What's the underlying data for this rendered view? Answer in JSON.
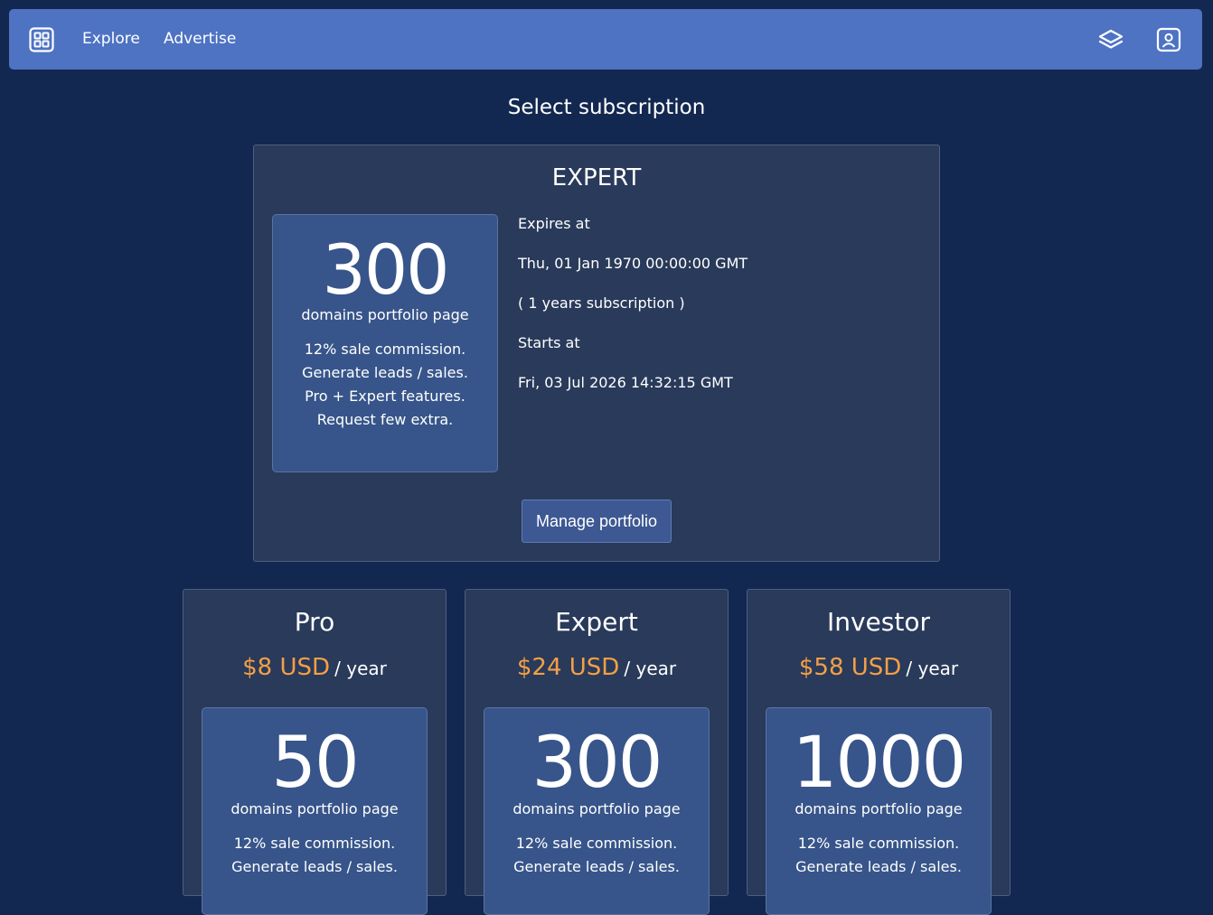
{
  "nav": {
    "logo_icon": "grid-icon",
    "links": [
      "Explore",
      "Advertise"
    ],
    "right_icons": [
      "layers-icon",
      "profile-icon"
    ]
  },
  "page_title": "Select subscription",
  "current": {
    "tier": "EXPERT",
    "count": "300",
    "count_label": "domains portfolio page",
    "features": [
      "12% sale commission.",
      "Generate leads / sales.",
      "Pro + Expert features.",
      "Request few extra."
    ],
    "expires_label": "Expires at",
    "expires_value": "Thu, 01 Jan 1970 00:00:00 GMT",
    "duration": "( 1 years subscription )",
    "starts_label": "Starts at",
    "starts_value": "Fri, 03 Jul 2026 14:32:15 GMT",
    "manage_button": "Manage portfolio"
  },
  "plans": [
    {
      "name": "Pro",
      "price": "$8 USD",
      "period": "/ year",
      "count": "50",
      "count_label": "domains portfolio page",
      "features": [
        "12% sale commission.",
        "Generate leads / sales."
      ]
    },
    {
      "name": "Expert",
      "price": "$24 USD",
      "period": "/ year",
      "count": "300",
      "count_label": "domains portfolio page",
      "features": [
        "12% sale commission.",
        "Generate leads / sales."
      ]
    },
    {
      "name": "Investor",
      "price": "$58 USD",
      "period": "/ year",
      "count": "1000",
      "count_label": "domains portfolio page",
      "features": [
        "12% sale commission.",
        "Generate leads / sales."
      ]
    }
  ],
  "colors": {
    "background": "#132850",
    "navbar": "#4e73c3",
    "panel": "#293a5a",
    "card": "#37558a",
    "price_accent": "#f49f45"
  }
}
